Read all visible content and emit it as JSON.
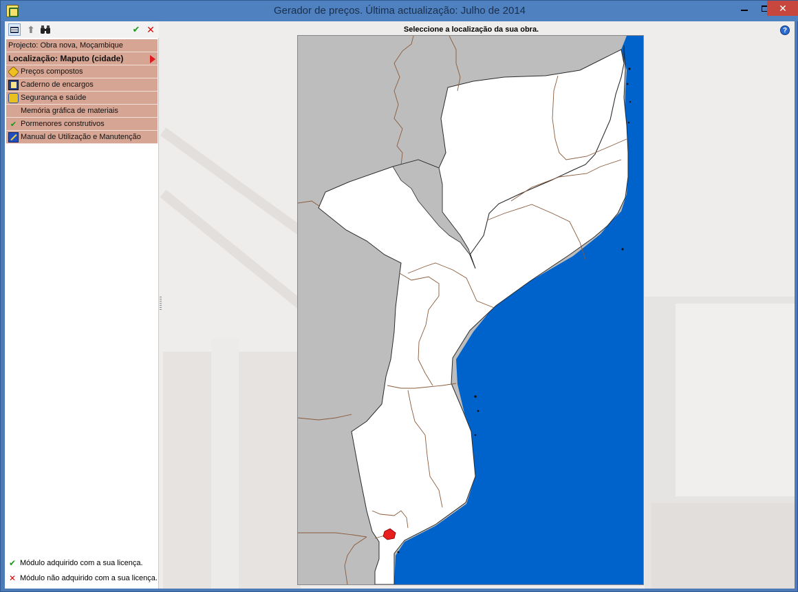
{
  "window": {
    "title": "Gerador de preços. Última actualização: Julho de 2014",
    "close_glyph": "✕"
  },
  "toolbar": {
    "icons": [
      "list-view-icon",
      "up-arrow-icon",
      "binoculars-icon",
      "accept-check-icon",
      "cancel-x-icon"
    ],
    "up_glyph": "⬆",
    "find_glyph": "🔭",
    "ok_glyph": "✔",
    "cancel_glyph": "✕"
  },
  "sidebar": {
    "project": "Projecto: Obra nova, Moçambique",
    "location": "Localização: Maputo (cidade)",
    "items": [
      {
        "label": "Preços compostos",
        "icon": "price-tag-icon"
      },
      {
        "label": "Caderno de encargos",
        "icon": "book-icon"
      },
      {
        "label": "Segurança e saúde",
        "icon": "safety-helmet-icon"
      },
      {
        "label": "Memória gráfica de materiais",
        "icon": ""
      },
      {
        "label": "Pormenores construtivos",
        "icon": "check-icon",
        "glyph": "✔"
      },
      {
        "label": "Manual de Utilização e Manutenção",
        "icon": "wrench-icon"
      }
    ]
  },
  "legend": {
    "acquired": "Módulo adquirido com a sua licença.",
    "not_acquired": "Módulo não adquirido com a sua licença.",
    "acquired_glyph": "✔",
    "not_acquired_glyph": "✕"
  },
  "main": {
    "prompt": "Seleccione a localização da sua obra.",
    "help_glyph": "?"
  },
  "map": {
    "country": "Moçambique",
    "selected_region": "Maputo (cidade)",
    "colors": {
      "land": "#ffffff",
      "neighbors": "#bdbdbd",
      "ocean": "#0063cc",
      "borders": "#7a5a3a",
      "selected": "#e81d1d"
    }
  }
}
